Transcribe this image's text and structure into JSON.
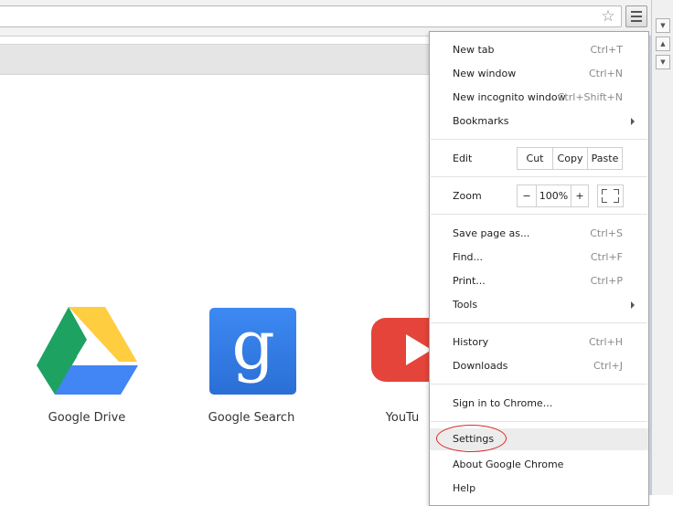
{
  "menu": {
    "new_tab": {
      "label": "New tab",
      "shortcut": "Ctrl+T"
    },
    "new_window": {
      "label": "New window",
      "shortcut": "Ctrl+N"
    },
    "new_incognito": {
      "label": "New incognito window",
      "shortcut": "Ctrl+Shift+N"
    },
    "bookmarks": {
      "label": "Bookmarks"
    },
    "edit": {
      "label": "Edit",
      "cut": "Cut",
      "copy": "Copy",
      "paste": "Paste"
    },
    "zoom": {
      "label": "Zoom",
      "minus": "−",
      "value": "100%",
      "plus": "+"
    },
    "save_page": {
      "label": "Save page as...",
      "shortcut": "Ctrl+S"
    },
    "find": {
      "label": "Find...",
      "shortcut": "Ctrl+F"
    },
    "print": {
      "label": "Print...",
      "shortcut": "Ctrl+P"
    },
    "tools": {
      "label": "Tools"
    },
    "history": {
      "label": "History",
      "shortcut": "Ctrl+H"
    },
    "downloads": {
      "label": "Downloads",
      "shortcut": "Ctrl+J"
    },
    "sign_in": {
      "label": "Sign in to Chrome..."
    },
    "settings": {
      "label": "Settings"
    },
    "about": {
      "label": "About Google Chrome"
    },
    "help": {
      "label": "Help"
    }
  },
  "apps": [
    {
      "label": "Google Drive",
      "icon": "google-drive-icon"
    },
    {
      "label": "Google Search",
      "icon": "google-search-icon"
    },
    {
      "label": "YouTu",
      "icon": "youtube-icon"
    }
  ],
  "colors": {
    "highlight_ring": "#d52b2b",
    "drive_green": "#1da261",
    "drive_yellow": "#ffcd40",
    "drive_blue": "#4285f4",
    "search_blue": "#3d89f2",
    "youtube_red": "#e5443a"
  }
}
